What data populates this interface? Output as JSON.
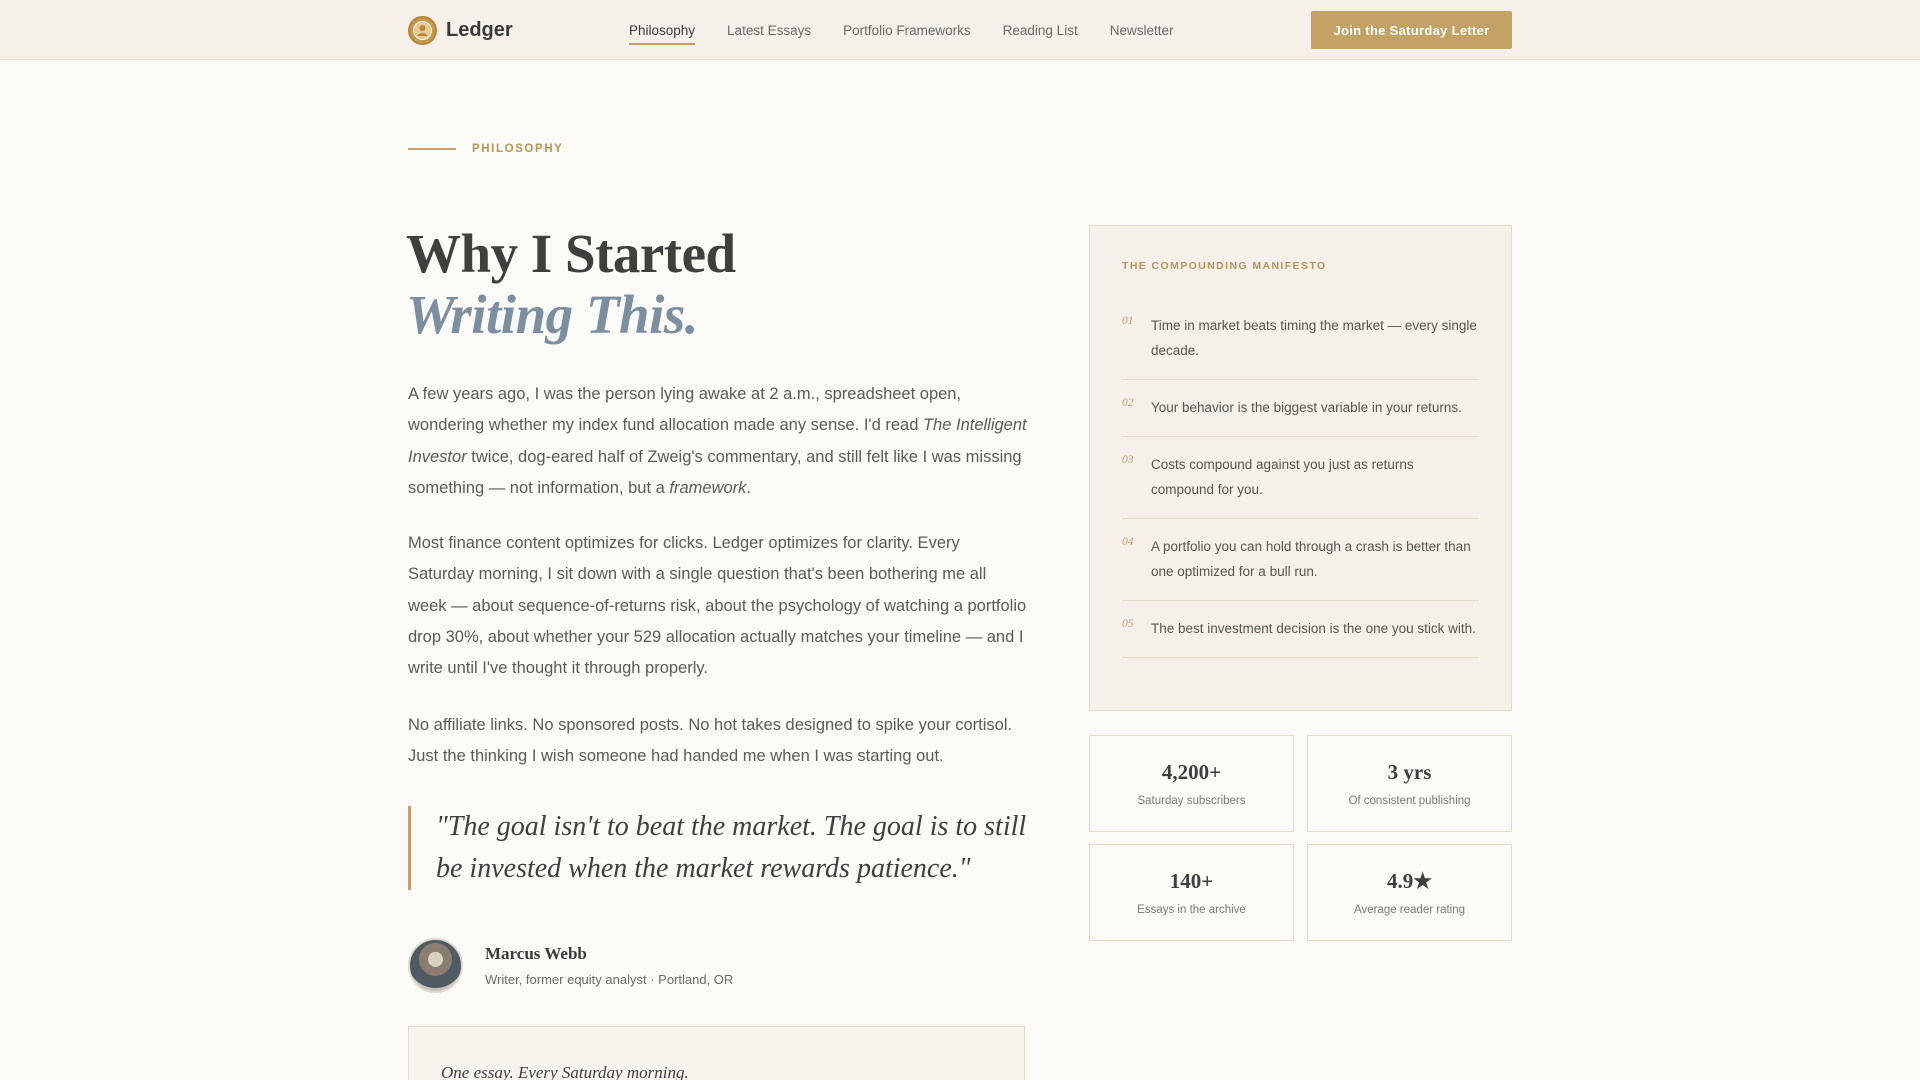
{
  "header": {
    "brand": "Ledger",
    "nav": [
      "Philosophy",
      "Latest Essays",
      "Portfolio Frameworks",
      "Reading List",
      "Newsletter"
    ],
    "active_nav": "Philosophy",
    "cta": "Join the Saturday Letter"
  },
  "hero": {
    "eyebrow": "PHILOSOPHY",
    "title_line1": "Why I Started",
    "title_line2": "Writing This."
  },
  "body": {
    "p1": {
      "a": "A few years ago, I was the person lying awake at 2 a.m., spreadsheet open, wondering whether my index fund allocation made any sense. I'd read ",
      "em1": "The Intelligent Investor",
      "b": " twice, dog-eared half of Zweig's commentary, and still felt like I was missing something — not information, but a ",
      "em2": "framework",
      "c": "."
    },
    "p2": "Most finance content optimizes for clicks. Ledger optimizes for clarity. Every Saturday morning, I sit down with a single question that's been bothering me all week — about sequence-of-returns risk, about the psychology of watching a portfolio drop 30%, about whether your 529 allocation actually matches your timeline — and I write until I've thought it through properly.",
    "p3": "No affiliate links. No sponsored posts. No hot takes designed to spike your cortisol. Just the thinking I wish someone had handed me when I was starting out."
  },
  "quote": "\"The goal isn't to beat the market. The goal is to still be invested when the market rewards patience.\"",
  "author": {
    "name": "Marcus Webb",
    "meta": "Writer, former equity analyst · Portland, OR"
  },
  "teaser": "One essay. Every Saturday morning.",
  "manifesto": {
    "title": "THE COMPOUNDING MANIFESTO",
    "items": [
      {
        "num": "01",
        "text": "Time in market beats timing the market — every single decade."
      },
      {
        "num": "02",
        "text": "Your behavior is the biggest variable in your returns."
      },
      {
        "num": "03",
        "text": "Costs compound against you just as returns compound for you."
      },
      {
        "num": "04",
        "text": "A portfolio you can hold through a crash is better than one optimized for a bull run."
      },
      {
        "num": "05",
        "text": "The best investment decision is the one you stick with."
      }
    ]
  },
  "stats": [
    {
      "value": "4,200+",
      "label": "Saturday subscribers"
    },
    {
      "value": "3 yrs",
      "label": "Of consistent publishing"
    },
    {
      "value": "140+",
      "label": "Essays in the archive"
    },
    {
      "value": "4.9★",
      "label": "Average reader rating"
    }
  ],
  "colors": {
    "accent": "#c4a266",
    "page_bg": "#fbfaf6",
    "header_bg": "#f5f1ea",
    "title_italic": "#7c8fa0"
  }
}
